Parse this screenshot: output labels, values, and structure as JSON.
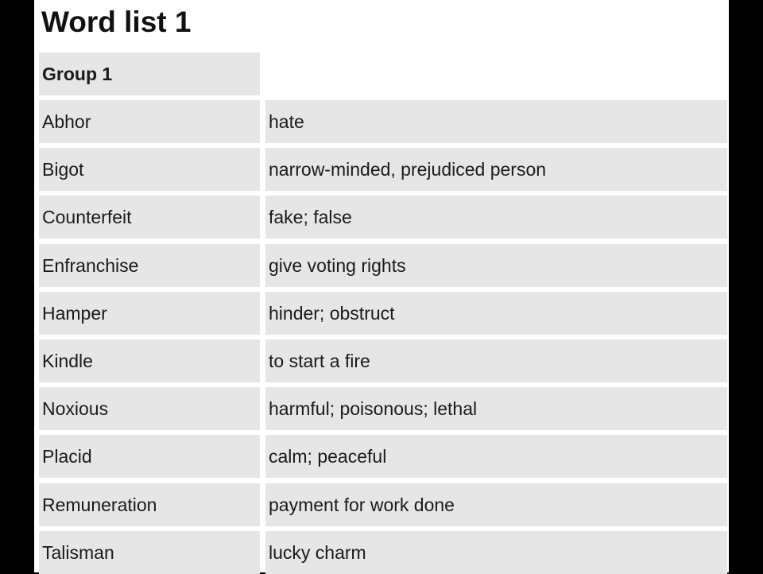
{
  "title": "Word list 1",
  "group_header": "Group 1",
  "rows": [
    {
      "word": "Abhor",
      "definition": "hate"
    },
    {
      "word": "Bigot",
      "definition": "narrow-minded, prejudiced person"
    },
    {
      "word": "Counterfeit",
      "definition": "fake; false"
    },
    {
      "word": "Enfranchise",
      "definition": "give voting rights"
    },
    {
      "word": "Hamper",
      "definition": "hinder; obstruct"
    },
    {
      "word": "Kindle",
      "definition": "to start a fire"
    },
    {
      "word": "Noxious",
      "definition": "harmful; poisonous; lethal"
    },
    {
      "word": "Placid",
      "definition": "calm; peaceful"
    },
    {
      "word": "Remuneration",
      "definition": "payment for work done"
    },
    {
      "word": "Talisman",
      "definition": "lucky charm"
    }
  ]
}
